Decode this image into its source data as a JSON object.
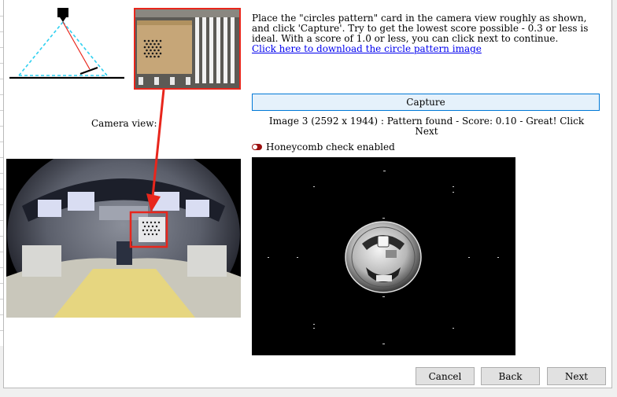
{
  "instructions": {
    "text": "Place the \"circles pattern\" card in the camera view roughly as shown, and click 'Capture'. Try to get the lowest score possible - 0.3 or less is ideal.  With a score of 1.0 or less, you can click next to continue.",
    "download_link": "Click here to download the circle pattern image"
  },
  "camera_view_label": "Camera view:",
  "capture_label": "Capture",
  "status": {
    "line1": "Image 3 (2592 x 1944) : Pattern found - Score: 0.10 - Great! Click",
    "line2": "Next"
  },
  "honeycomb": {
    "label": "Honeycomb check enabled",
    "enabled": true
  },
  "buttons": {
    "cancel": "Cancel",
    "back": "Back",
    "next": "Next"
  },
  "colors": {
    "highlight": "#e8261c",
    "link": "#0000ee",
    "capture_border": "#0078d7",
    "toggle_on": "#9b1010"
  }
}
